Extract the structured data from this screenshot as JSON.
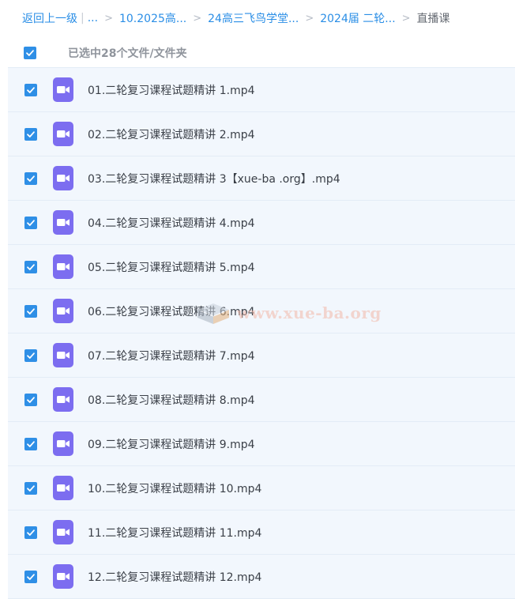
{
  "breadcrumb": {
    "back_label": "返回上一级",
    "separator": "|",
    "more": "...",
    "items": [
      "10.2025高...",
      "24高三飞鸟学堂...",
      "2024届 二轮..."
    ],
    "current": "直播课"
  },
  "selection": {
    "count_text": "已选中28个文件/文件夹"
  },
  "files": [
    {
      "name": "01.二轮复习课程试题精讲 1.mp4",
      "checked": true
    },
    {
      "name": "02.二轮复习课程试题精讲 2.mp4",
      "checked": true
    },
    {
      "name": "03.二轮复习课程试题精讲 3【xue-ba .org】.mp4",
      "checked": true
    },
    {
      "name": "04.二轮复习课程试题精讲 4.mp4",
      "checked": true
    },
    {
      "name": "05.二轮复习课程试题精讲 5.mp4",
      "checked": true
    },
    {
      "name": "06.二轮复习课程试题精讲 6.mp4",
      "checked": true
    },
    {
      "name": "07.二轮复习课程试题精讲 7.mp4",
      "checked": true
    },
    {
      "name": "08.二轮复习课程试题精讲 8.mp4",
      "checked": true
    },
    {
      "name": "09.二轮复习课程试题精讲 9.mp4",
      "checked": true
    },
    {
      "name": "10.二轮复习课程试题精讲 10.mp4",
      "checked": true
    },
    {
      "name": "11.二轮复习课程试题精讲 11.mp4",
      "checked": true
    },
    {
      "name": "12.二轮复习课程试题精讲 12.mp4",
      "checked": true
    }
  ],
  "watermark": {
    "text": "www.xue-ba.org"
  },
  "icons": {
    "checkbox": "checkmark-icon",
    "file": "video-file-icon"
  },
  "colors": {
    "accent": "#2f8fe6",
    "link": "#2a8ee6",
    "row_bg": "#f2f7fd",
    "video_icon": "#7c6df0"
  }
}
